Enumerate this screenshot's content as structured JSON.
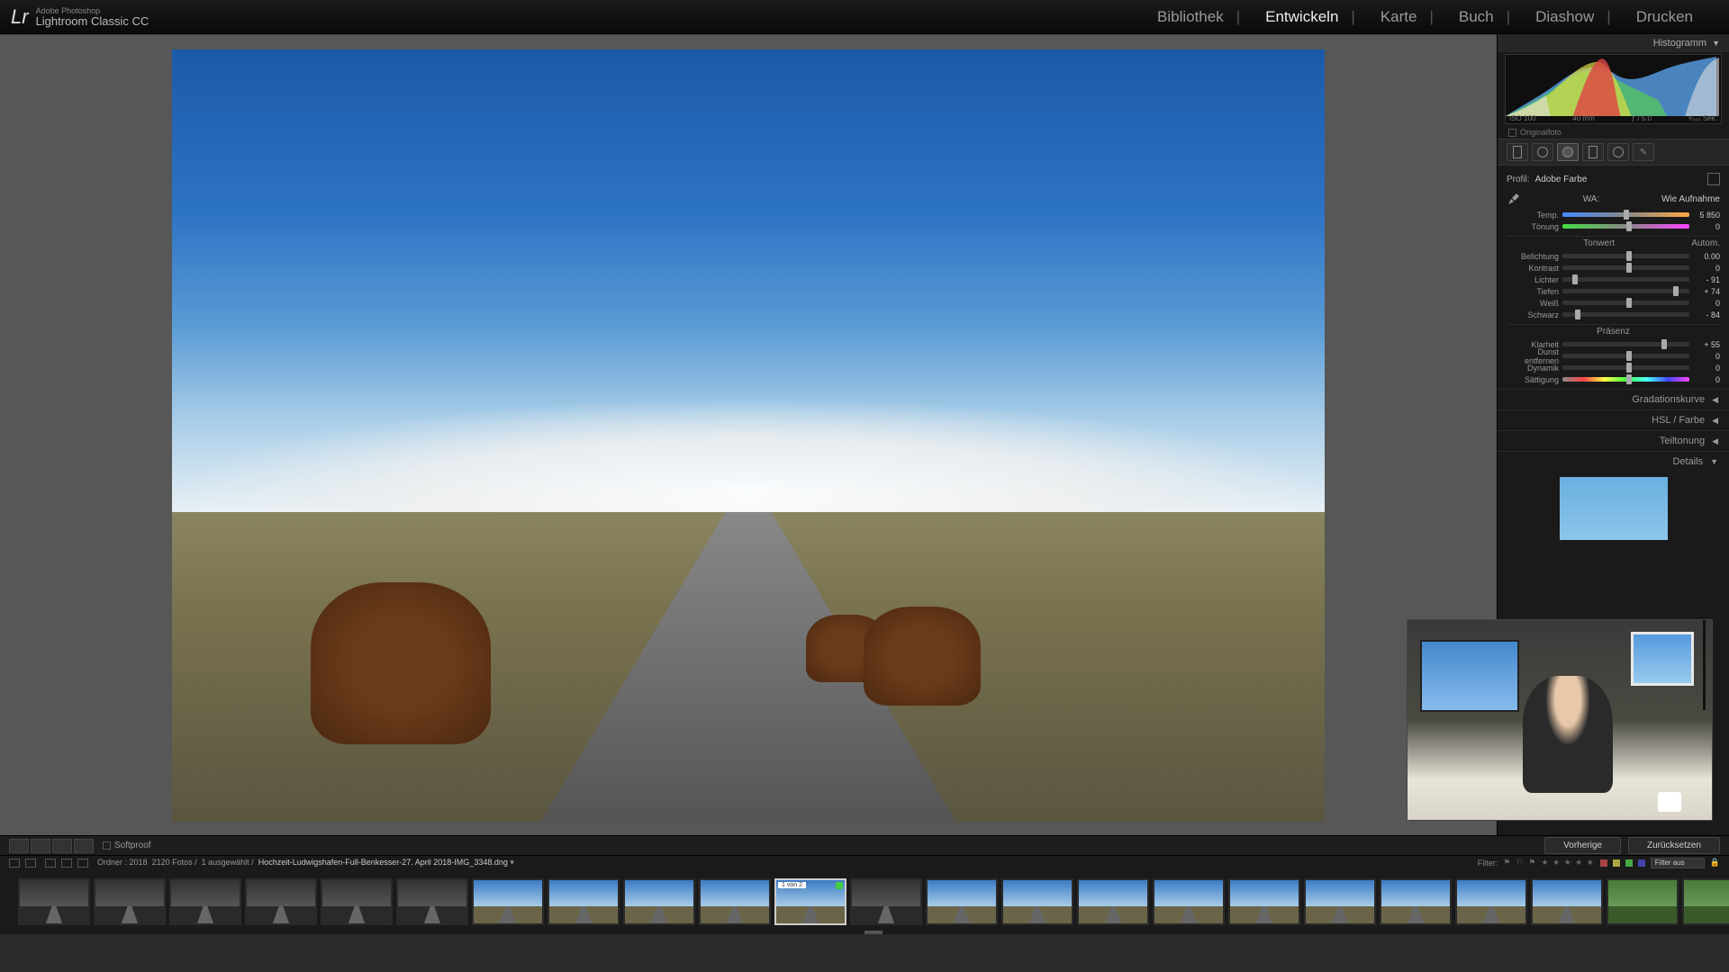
{
  "app": {
    "brand": "Adobe Photoshop",
    "product": "Lightroom Classic CC"
  },
  "modules": {
    "library": "Bibliothek",
    "develop": "Entwickeln",
    "map": "Karte",
    "book": "Buch",
    "slideshow": "Diashow",
    "print": "Drucken"
  },
  "histogram": {
    "title": "Histogramm",
    "iso": "ISO 100",
    "focal": "40 mm",
    "aperture": "ƒ / 5.0",
    "shutter": "¹⁄₅₀₀ Sek.",
    "original_label": "Originalfoto"
  },
  "basic": {
    "profile_label": "Profil:",
    "profile_value": "Adobe Farbe",
    "wb_label": "WA:",
    "wb_value": "Wie Aufnahme",
    "temp_label": "Temp.",
    "temp_value": "5 850",
    "tint_label": "Tönung",
    "tint_value": "0",
    "tone_header": "Tonwert",
    "auto_label": "Autom.",
    "exposure_label": "Belichtung",
    "exposure_value": "0.00",
    "contrast_label": "Kontrast",
    "contrast_value": "0",
    "highlights_label": "Lichter",
    "highlights_value": "- 91",
    "shadows_label": "Tiefen",
    "shadows_value": "+ 74",
    "whites_label": "Weiß",
    "whites_value": "0",
    "blacks_label": "Schwarz",
    "blacks_value": "- 84",
    "presence_header": "Präsenz",
    "clarity_label": "Klarheit",
    "clarity_value": "+ 55",
    "dehaze_label": "Dunst entfernen",
    "dehaze_value": "0",
    "vibrance_label": "Dynamik",
    "vibrance_value": "0",
    "saturation_label": "Sättigung",
    "saturation_value": "0"
  },
  "panels": {
    "tone_curve": "Gradationskurve",
    "hsl": "HSL / Farbe",
    "split": "Teiltonung",
    "detail": "Details"
  },
  "toolbar": {
    "softproof": "Softproof",
    "previous": "Vorherige",
    "reset": "Zurücksetzen"
  },
  "filmstrip": {
    "folder_label": "Ordner :",
    "folder_value": "2018",
    "count": "2120 Fotos /",
    "selected": "1 ausgewählt /",
    "filename": "Hochzeit-Ludwigshafen-Full-Benkesser-27. April 2018-IMG_3348.dng",
    "filter_label": "Filter:",
    "filter_off": "Filter aus",
    "thumb_badge": "1 von 2"
  }
}
